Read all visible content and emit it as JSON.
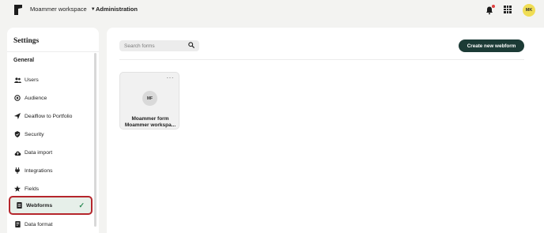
{
  "topbar": {
    "workspace": "Moammer workspace",
    "breadcrumb": "Administration",
    "avatar_initials": "MK",
    "notification_dot_color": "#e04040"
  },
  "sidebar": {
    "title": "Settings",
    "group": "General",
    "items": [
      {
        "label": "Users",
        "icon": "users-icon"
      },
      {
        "label": "Audience",
        "icon": "audience-icon"
      },
      {
        "label": "Dealflow to Portfolio",
        "icon": "send-icon"
      },
      {
        "label": "Security",
        "icon": "shield-icon"
      },
      {
        "label": "Data import",
        "icon": "cloud-upload-icon"
      },
      {
        "label": "Integrations",
        "icon": "plug-icon"
      },
      {
        "label": "Fields",
        "icon": "star-icon"
      },
      {
        "label": "Webforms",
        "icon": "form-icon",
        "active": true
      },
      {
        "label": "Data format",
        "icon": "document-icon"
      }
    ]
  },
  "main": {
    "search_placeholder": "Search forms",
    "create_button": "Create new webform",
    "card": {
      "initials": "MF",
      "line1": "Moammer form",
      "line2": "Moammer workspa..."
    }
  },
  "colors": {
    "accent": "#1c3b36",
    "active_bg": "#e6efe9",
    "highlight_border": "#b5262c",
    "check": "#2c8a55",
    "avatar_bg": "#f0dd54"
  }
}
